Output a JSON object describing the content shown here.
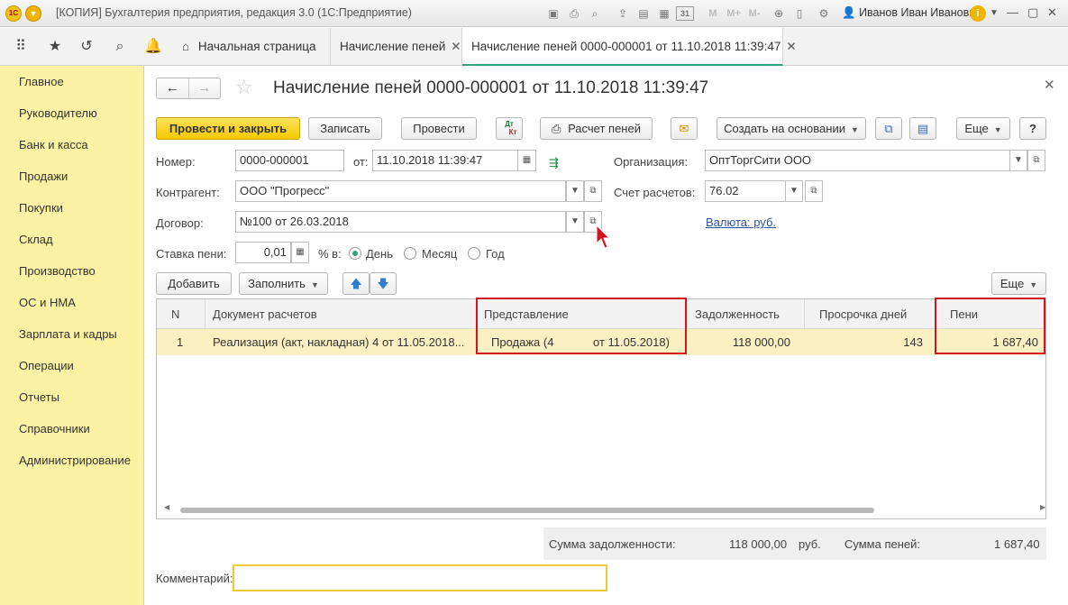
{
  "app": {
    "logo": "1С",
    "title": "[КОПИЯ] Бухгалтерия предприятия, редакция 3.0  (1С:Предприятие)",
    "toolbar_m_labels": [
      "M",
      "M+",
      "M-"
    ],
    "calendar_day": "31",
    "user": "Иванов Иван Иванович"
  },
  "tabs": [
    {
      "label": "Начальная страница"
    },
    {
      "label": "Начисление пеней"
    },
    {
      "label": "Начисление пеней 0000-000001 от 11.10.2018 11:39:47"
    }
  ],
  "sidebar": {
    "items": [
      {
        "label": "Главное"
      },
      {
        "label": "Руководителю"
      },
      {
        "label": "Банк и касса"
      },
      {
        "label": "Продажи"
      },
      {
        "label": "Покупки"
      },
      {
        "label": "Склад"
      },
      {
        "label": "Производство"
      },
      {
        "label": "ОС и НМА"
      },
      {
        "label": "Зарплата и кадры"
      },
      {
        "label": "Операции"
      },
      {
        "label": "Отчеты"
      },
      {
        "label": "Справочники"
      },
      {
        "label": "Администрирование"
      }
    ]
  },
  "document": {
    "title": "Начисление пеней 0000-000001 от 11.10.2018 11:39:47"
  },
  "toolbar": {
    "post_close": "Провести и закрыть",
    "save": "Записать",
    "post": "Провести",
    "dt_label": "Дт",
    "kt_label": "Кт",
    "calc": "Расчет пеней",
    "create_based": "Создать на основании",
    "more": "Еще",
    "help": "?"
  },
  "form": {
    "number_label": "Номер:",
    "number_value": "0000-000001",
    "date_label": "от:",
    "date_value": "11.10.2018 11:39:47",
    "org_label": "Организация:",
    "org_value": "ОптТоргСити ООО",
    "contractor_label": "Контрагент:",
    "contractor_value": "ООО \"Прогресс\"",
    "account_label": "Счет расчетов:",
    "account_value": "76.02",
    "contract_label": "Договор:",
    "contract_value": "№100 от 26.03.2018",
    "currency_link": "Валюта: руб.",
    "rate_label": "Ставка пени:",
    "rate_value": "0,01",
    "percent_label": "% в:",
    "period_options": [
      "День",
      "Месяц",
      "Год"
    ],
    "period_selected": "День"
  },
  "table_toolbar": {
    "add": "Добавить",
    "fill": "Заполнить",
    "more": "Еще"
  },
  "table": {
    "columns": [
      "N",
      "Документ расчетов",
      "Представление",
      "Задолженность",
      "Просрочка дней",
      "Пени"
    ],
    "rows": [
      {
        "n": "1",
        "document": "Реализация (акт, накладная) 4 от 11.05.2018...",
        "presentation_left": "Продажа (4",
        "presentation_right": "от 11.05.2018)",
        "debt": "118 000,00",
        "overdue_days": "143",
        "penalty": "1 687,40"
      }
    ]
  },
  "summary": {
    "debt_label": "Сумма задолженности:",
    "debt_value": "118 000,00",
    "currency": "руб.",
    "penalty_label": "Сумма пеней:",
    "penalty_value": "1 687,40"
  },
  "comment": {
    "label": "Комментарий:",
    "value": ""
  },
  "colors": {
    "sidebar_bg": "#fdf1a3",
    "primary_button": "#f5c800",
    "active_row": "#fbf0c2",
    "highlight_border": "#d2141e",
    "link": "#2b53a8"
  }
}
